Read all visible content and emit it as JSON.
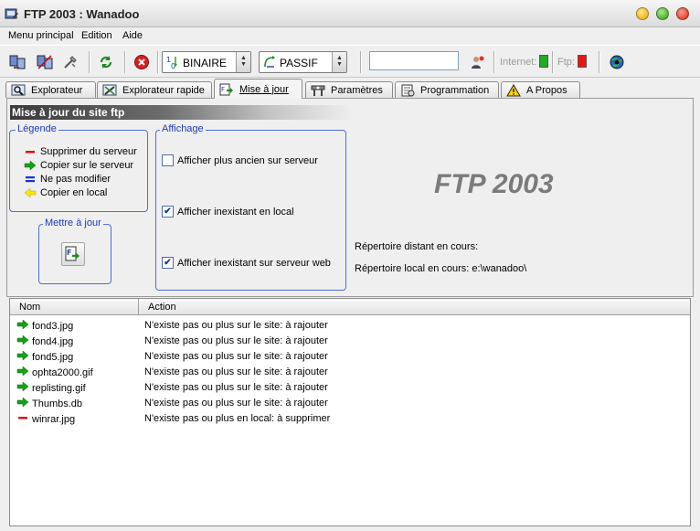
{
  "window": {
    "title": "FTP 2003 : Wanadoo"
  },
  "menu": [
    "Menu principal",
    "Edition",
    "Aide"
  ],
  "toolbar": {
    "transfer_mode": "BINAIRE",
    "connection_mode": "PASSIF",
    "server_value": "",
    "internet_label": "Internet:",
    "ftp_label": "Ftp:",
    "internet_status_color": "#22aa22",
    "ftp_status_color": "#ee1111"
  },
  "tabs": [
    {
      "label": "Explorateur",
      "icon": "explorer-icon"
    },
    {
      "label": "Explorateur rapide",
      "icon": "quick-explorer-icon"
    },
    {
      "label": "Mise à jour",
      "icon": "update-icon",
      "active": true
    },
    {
      "label": "Paramètres",
      "icon": "settings-icon"
    },
    {
      "label": "Programmation",
      "icon": "schedule-icon"
    },
    {
      "label": "A Propos",
      "icon": "warning-icon"
    }
  ],
  "section_title": "Mise à jour du site ftp",
  "legend": {
    "title": "Légende",
    "items": [
      {
        "label": "Supprimer du serveur",
        "icon": "red-dash-icon"
      },
      {
        "label": "Copier sur le serveur",
        "icon": "green-arrow-right-icon"
      },
      {
        "label": "Ne pas modifier",
        "icon": "blue-equals-icon"
      },
      {
        "label": "Copier en local",
        "icon": "yellow-arrow-left-icon"
      }
    ]
  },
  "update": {
    "title": "Mettre à jour"
  },
  "display": {
    "title": "Affichage",
    "options": [
      {
        "label": "Afficher plus ancien sur serveur",
        "checked": false
      },
      {
        "label": "Afficher inexistant en local",
        "checked": true
      },
      {
        "label": "Afficher inexistant sur serveur web",
        "checked": true
      }
    ]
  },
  "brand": "FTP 2003",
  "remote_dir_label": "Répertoire distant en cours:",
  "local_dir_label": "Répertoire local en cours: e:\\wanadoo\\",
  "files": {
    "columns": [
      "Nom",
      "Action"
    ],
    "rows": [
      {
        "name": "fond3.jpg",
        "action": "N'existe pas ou plus sur le site: à rajouter",
        "icon": "green-arrow-right-icon"
      },
      {
        "name": "fond4.jpg",
        "action": "N'existe pas ou plus sur le site: à rajouter",
        "icon": "green-arrow-right-icon"
      },
      {
        "name": "fond5.jpg",
        "action": "N'existe pas ou plus sur le site: à rajouter",
        "icon": "green-arrow-right-icon"
      },
      {
        "name": "ophta2000.gif",
        "action": "N'existe pas ou plus sur le site: à rajouter",
        "icon": "green-arrow-right-icon"
      },
      {
        "name": "replisting.gif",
        "action": "N'existe pas ou plus sur le site: à rajouter",
        "icon": "green-arrow-right-icon"
      },
      {
        "name": "Thumbs.db",
        "action": "N'existe pas ou plus sur le site: à rajouter",
        "icon": "green-arrow-right-icon"
      },
      {
        "name": "winrar.jpg",
        "action": "N'existe pas ou plus en local: à supprimer",
        "icon": "red-dash-icon"
      }
    ]
  }
}
